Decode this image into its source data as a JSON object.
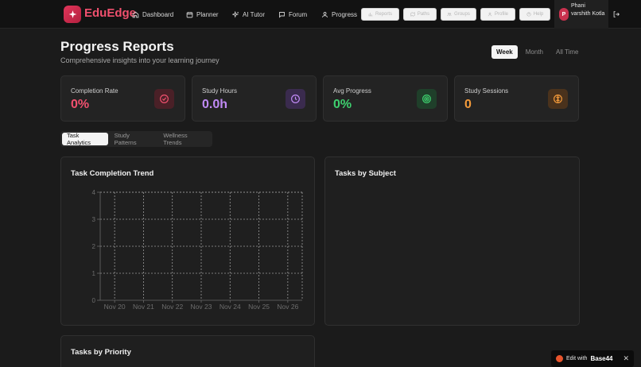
{
  "app": {
    "name": "EduEdge"
  },
  "nav": {
    "links": [
      {
        "label": "Dashboard",
        "icon": "home-icon"
      },
      {
        "label": "Planner",
        "icon": "calendar-icon"
      },
      {
        "label": "AI Tutor",
        "icon": "sparkles-icon"
      },
      {
        "label": "Forum",
        "icon": "chat-icon"
      },
      {
        "label": "Progress",
        "icon": "user-icon"
      }
    ],
    "pills": [
      {
        "label": "Reports",
        "icon": "chart-icon"
      },
      {
        "label": "Paths",
        "icon": "map-icon"
      },
      {
        "label": "Groups",
        "icon": "users-icon"
      },
      {
        "label": "Profile",
        "icon": "user-icon"
      },
      {
        "label": "Help",
        "icon": "help-icon"
      }
    ]
  },
  "user": {
    "initial": "P",
    "name": "Phani varshith Kotla"
  },
  "header": {
    "title": "Progress Reports",
    "subtitle": "Comprehensive insights into your learning journey",
    "ranges": [
      "Week",
      "Month",
      "All Time"
    ],
    "active_range": "Week"
  },
  "stats": [
    {
      "label": "Completion Rate",
      "value": "0%",
      "color": "#f0506e",
      "icon": "check-circle-icon",
      "icon_bg": "#4a2027"
    },
    {
      "label": "Study Hours",
      "value": "0.0h",
      "color": "#c08af5",
      "icon": "clock-icon",
      "icon_bg": "#3a2b4e"
    },
    {
      "label": "Avg Progress",
      "value": "0%",
      "color": "#3ecf6e",
      "icon": "target-icon",
      "icon_bg": "#1f3f2a"
    },
    {
      "label": "Study Sessions",
      "value": "0",
      "color": "#f39a3a",
      "icon": "brain-icon",
      "icon_bg": "#4a321c"
    }
  ],
  "analytics_tabs": [
    "Task Analytics",
    "Study Patterns",
    "Wellness Trends"
  ],
  "panels": {
    "trend_title": "Task Completion Trend",
    "subject_title": "Tasks by Subject",
    "priority_title": "Tasks by Priority"
  },
  "chart_data": {
    "type": "line",
    "title": "Task Completion Trend",
    "categories": [
      "Nov 20",
      "Nov 21",
      "Nov 22",
      "Nov 23",
      "Nov 24",
      "Nov 25",
      "Nov 26"
    ],
    "y_ticks": [
      0,
      1,
      2,
      3,
      4
    ],
    "ylim": [
      0,
      4
    ],
    "series": [],
    "grid": true
  },
  "edit_badge": {
    "prefix": "Edit with",
    "brand": "Base44",
    "close": "✕"
  }
}
